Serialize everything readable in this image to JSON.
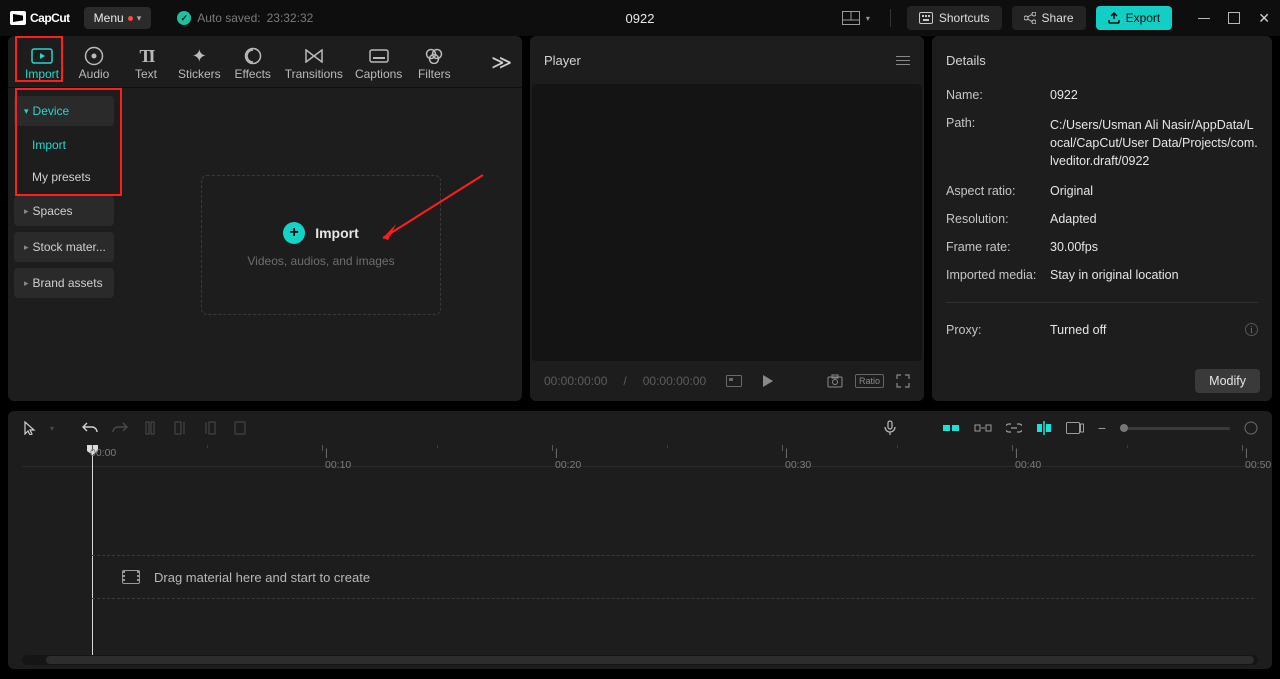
{
  "app": {
    "brand": "CapCut",
    "menu_label": "Menu"
  },
  "autosave": {
    "prefix": "Auto saved:",
    "time": "23:32:32"
  },
  "project": {
    "title": "0922"
  },
  "titlebar": {
    "shortcuts": "Shortcuts",
    "share": "Share",
    "export": "Export"
  },
  "mediaTabs": {
    "import": "Import",
    "audio": "Audio",
    "text": "Text",
    "stickers": "Stickers",
    "effects": "Effects",
    "transitions": "Transitions",
    "captions": "Captions",
    "filters": "Filters"
  },
  "mediaSide": {
    "device": "Device",
    "import": "Import",
    "myPresets": "My presets",
    "spaces": "Spaces",
    "stock": "Stock mater...",
    "brand": "Brand assets"
  },
  "drop": {
    "title": "Import",
    "sub": "Videos, audios, and images"
  },
  "player": {
    "title": "Player",
    "time_current": "00:00:00:00",
    "time_total": "00:00:00:00",
    "ratio_btn": "Ratio"
  },
  "details": {
    "title": "Details",
    "name_lbl": "Name:",
    "name_val": "0922",
    "path_lbl": "Path:",
    "path_val": "C:/Users/Usman Ali Nasir/AppData/Local/CapCut/User Data/Projects/com.lveditor.draft/0922",
    "aspect_lbl": "Aspect ratio:",
    "aspect_val": "Original",
    "res_lbl": "Resolution:",
    "res_val": "Adapted",
    "fps_lbl": "Frame rate:",
    "fps_val": "30.00fps",
    "impmedia_lbl": "Imported media:",
    "impmedia_val": "Stay in original location",
    "proxy_lbl": "Proxy:",
    "proxy_val": "Turned off",
    "modify": "Modify"
  },
  "timeline": {
    "hint": "Drag material here and start to create",
    "ticks": [
      {
        "pos": 70,
        "label": "00:00",
        "major": true
      },
      {
        "pos": 185,
        "label": "",
        "major": false
      },
      {
        "pos": 300,
        "label": "00:10",
        "major": true
      },
      {
        "pos": 415,
        "label": "",
        "major": false
      },
      {
        "pos": 530,
        "label": "00:20",
        "major": true
      },
      {
        "pos": 645,
        "label": "",
        "major": false
      },
      {
        "pos": 760,
        "label": "00:30",
        "major": true
      },
      {
        "pos": 875,
        "label": "",
        "major": false
      },
      {
        "pos": 990,
        "label": "00:40",
        "major": true
      },
      {
        "pos": 1105,
        "label": "",
        "major": false
      },
      {
        "pos": 1220,
        "label": "00:50",
        "major": true
      }
    ]
  }
}
